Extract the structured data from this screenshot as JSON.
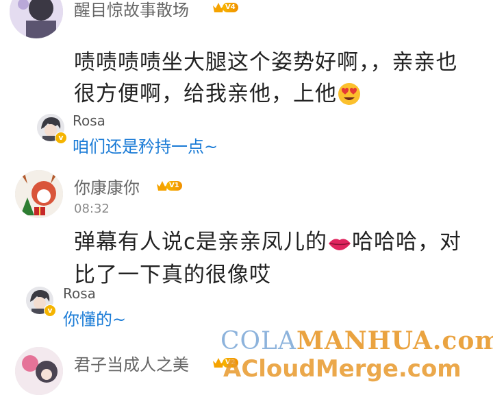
{
  "comments": [
    {
      "username": "醒目惊故事散场",
      "level": "V4",
      "text_line1": "啧啧啧啧坐大腿这个姿势好啊，，亲亲也",
      "text_line2_before_emoji": "很方便啊，给我亲他，上他",
      "emoji": "heart-eyes-face"
    },
    {
      "username": "你康康你",
      "level": "V1",
      "time": "08:32",
      "text_line1_before_emoji": "弹幕有人说c是亲亲凤儿的",
      "text_line1_after_emoji": "哈哈哈，对",
      "text_line2": "比了一下真的很像哎",
      "emoji": "lips"
    },
    {
      "username": "君子当成人之美",
      "level": "V2"
    }
  ],
  "replies": [
    {
      "name": "Rosa",
      "text": "咱们还是矜持一点~",
      "verified_mark": "v"
    },
    {
      "name": "Rosa",
      "text": "你懂的~",
      "verified_mark": "v"
    }
  ],
  "watermark": {
    "line1_part1": "COLA",
    "line1_part2": "MANHUA.com",
    "line2": "ACloudMerge.com"
  },
  "colors": {
    "reply_text": "#1a7bd6",
    "level_badge": "#f5a300",
    "watermark_blue": "#7aa6d6",
    "watermark_orange": "#e89a2c"
  }
}
